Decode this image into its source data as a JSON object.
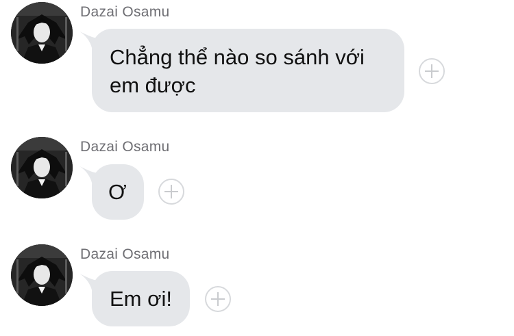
{
  "messages": [
    {
      "sender": "Dazai Osamu",
      "text_line1": "Chẳng thể nào so sánh với",
      "text_line2": "em được"
    },
    {
      "sender": "Dazai Osamu",
      "text": "Ơ"
    },
    {
      "sender": "Dazai Osamu",
      "text": "Em ơi!"
    }
  ],
  "colors": {
    "bubble": "#e5e7ea",
    "sender_text": "#6e6e73",
    "react_border": "#d7d9dc"
  },
  "icons": {
    "react_button": "plus-circle-icon"
  }
}
